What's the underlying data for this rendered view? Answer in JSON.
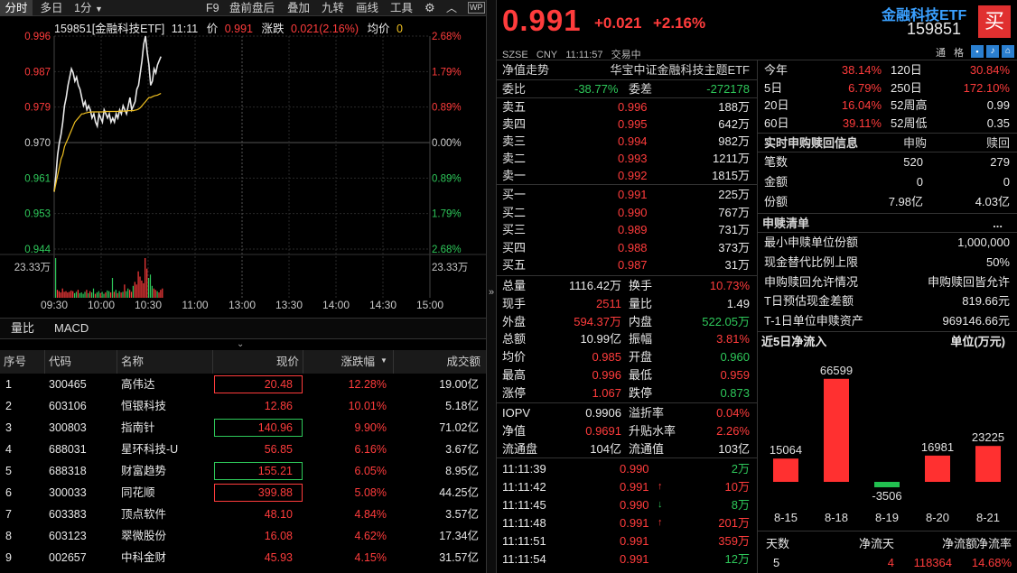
{
  "toolbar": {
    "left_items": [
      "分时",
      "多日",
      "1分"
    ],
    "right_items": [
      "F9",
      "盘前盘后",
      "叠加",
      "九转",
      "画线",
      "工具"
    ],
    "gear_icon": "gear-icon",
    "wechat_icon": "share-icon"
  },
  "chart_header": {
    "code_name": "159851[金融科技ETF]",
    "time": "11:11",
    "price_label": "价",
    "price": "0.991",
    "change_label": "涨跌",
    "change": "0.021(2.16%)",
    "avg_label": "均价",
    "avg": "0"
  },
  "chart_data": [
    {
      "type": "line",
      "x_ticks": [
        "09:30",
        "10:00",
        "10:30",
        "11:00",
        "13:00",
        "13:30",
        "14:00",
        "14:30",
        "15:00"
      ],
      "y_ticks_left": [
        "0.996",
        "0.987",
        "0.979",
        "0.970",
        "0.961",
        "0.953",
        "0.944"
      ],
      "y_ticks_right": [
        "2.68%",
        "1.79%",
        "0.89%",
        "0.00%",
        "0.89%",
        "1.79%",
        "2.68%"
      ],
      "ylim": [
        0.944,
        0.996
      ],
      "prev_close": 0.97,
      "series": [
        {
          "values": [
            0.958,
            0.962,
            0.967,
            0.97,
            0.972,
            0.975,
            0.979,
            0.981,
            0.984,
            0.986,
            0.988,
            0.987,
            0.985,
            0.986,
            0.984,
            0.983,
            0.981,
            0.979,
            0.98,
            0.978,
            0.979,
            0.978,
            0.976,
            0.977,
            0.975,
            0.974,
            0.977,
            0.976,
            0.975,
            0.978,
            0.977,
            0.976,
            0.977,
            0.975,
            0.976,
            0.975,
            0.977,
            0.976,
            0.978,
            0.977,
            0.979,
            0.978,
            0.977,
            0.979,
            0.981,
            0.978,
            0.979,
            0.98,
            0.983,
            0.984,
            0.987,
            0.99,
            0.994,
            0.996,
            0.992,
            0.989,
            0.984,
            0.985,
            0.988,
            0.987,
            0.989,
            0.99,
            0.991
          ]
        },
        {
          "values": [
            0.958,
            0.96,
            0.962,
            0.964,
            0.966,
            0.967,
            0.969,
            0.97,
            0.971,
            0.972,
            0.973,
            0.974,
            0.975,
            0.9755,
            0.976,
            0.9765,
            0.977,
            0.977,
            0.9772,
            0.9773,
            0.9774,
            0.9774,
            0.9775,
            0.9775,
            0.9775,
            0.9775,
            0.9775,
            0.9775,
            0.9775,
            0.9775,
            0.9776,
            0.9776,
            0.9776,
            0.9776,
            0.9776,
            0.9776,
            0.9776,
            0.9776,
            0.9777,
            0.9777,
            0.9777,
            0.9777,
            0.9777,
            0.9778,
            0.9778,
            0.9778,
            0.9778,
            0.9779,
            0.978,
            0.9782,
            0.9785,
            0.979,
            0.9795,
            0.98,
            0.9805,
            0.981,
            0.981,
            0.9812,
            0.9814,
            0.9815,
            0.9816,
            0.9818,
            0.982
          ]
        }
      ],
      "volume_label": "23.33万",
      "volume": [
        60,
        12,
        10,
        8,
        14,
        9,
        10,
        8,
        9,
        11,
        10,
        7,
        9,
        12,
        7,
        8,
        6,
        9,
        12,
        7,
        10,
        8,
        14,
        6,
        8,
        10,
        7,
        9,
        6,
        8,
        11,
        10,
        8,
        30,
        9,
        12,
        7,
        10,
        8,
        9,
        20,
        10,
        14,
        12,
        9,
        18,
        24,
        20,
        40,
        32,
        26,
        22,
        60,
        44,
        30,
        35,
        18,
        14,
        12,
        10,
        8,
        12,
        14
      ]
    },
    {
      "type": "bar",
      "title": "近5日净流入",
      "unit": "单位(万元)",
      "categories": [
        "8-15",
        "8-18",
        "8-19",
        "8-20",
        "8-21"
      ],
      "values": [
        15064,
        66599,
        -3506,
        16981,
        23225
      ]
    }
  ],
  "subtabs": [
    "量比",
    "MACD"
  ],
  "table": {
    "headers": [
      "序号",
      "代码",
      "名称",
      "现价",
      "涨跌幅",
      "成交额"
    ],
    "rows": [
      [
        "1",
        "300465",
        "高伟达",
        "20.48",
        "12.28%",
        "19.00亿"
      ],
      [
        "2",
        "603106",
        "恒银科技",
        "12.86",
        "10.01%",
        "5.18亿"
      ],
      [
        "3",
        "300803",
        "指南针",
        "140.96",
        "9.90%",
        "71.02亿"
      ],
      [
        "4",
        "688031",
        "星环科技-U",
        "56.85",
        "6.16%",
        "3.67亿"
      ],
      [
        "5",
        "688318",
        "财富趋势",
        "155.21",
        "6.05%",
        "8.95亿"
      ],
      [
        "6",
        "300033",
        "同花顺",
        "399.88",
        "5.08%",
        "44.25亿"
      ],
      [
        "7",
        "603383",
        "顶点软件",
        "48.10",
        "4.84%",
        "3.57亿"
      ],
      [
        "8",
        "603123",
        "翠微股份",
        "16.08",
        "4.62%",
        "17.34亿"
      ],
      [
        "9",
        "002657",
        "中科金财",
        "45.93",
        "4.15%",
        "31.57亿"
      ]
    ]
  },
  "quote": {
    "price": "0.991",
    "change": "+0.021",
    "change_pct": "+2.16%",
    "name": "金融科技ETF",
    "code": "159851",
    "buy_button": "买",
    "exchange": "SZSE",
    "currency": "CNY",
    "time": "11:11:57",
    "status": "交易中",
    "right_icons": [
      "通",
      "格",
      "bell-icon",
      "cart-icon"
    ],
    "nav_label": "净值走势",
    "index_name": "华宝中证金融科技主题ETF",
    "weibi_label": "委比",
    "weibi": "-38.77%",
    "weicha_label": "委差",
    "weicha": "-272178",
    "asks": [
      [
        "卖五",
        "0.996",
        "188万"
      ],
      [
        "卖四",
        "0.995",
        "642万"
      ],
      [
        "卖三",
        "0.994",
        "982万"
      ],
      [
        "卖二",
        "0.993",
        "1211万"
      ],
      [
        "卖一",
        "0.992",
        "1815万"
      ]
    ],
    "bids": [
      [
        "买一",
        "0.991",
        "225万"
      ],
      [
        "买二",
        "0.990",
        "767万"
      ],
      [
        "买三",
        "0.989",
        "731万"
      ],
      [
        "买四",
        "0.988",
        "373万"
      ],
      [
        "买五",
        "0.987",
        "31万"
      ]
    ],
    "stats": [
      [
        "总量",
        "1116.42万",
        "换手",
        "10.73%"
      ],
      [
        "现手",
        "2511",
        "量比",
        "1.49"
      ],
      [
        "外盘",
        "594.37万",
        "内盘",
        "522.05万"
      ],
      [
        "总额",
        "10.99亿",
        "振幅",
        "3.81%"
      ],
      [
        "均价",
        "0.985",
        "开盘",
        "0.960"
      ],
      [
        "最高",
        "0.996",
        "最低",
        "0.959"
      ],
      [
        "涨停",
        "1.067",
        "跌停",
        "0.873"
      ]
    ],
    "iopv": [
      [
        "IOPV",
        "0.9906",
        "溢折率",
        "0.04%"
      ],
      [
        "净值",
        "0.9691",
        "升贴水率",
        "2.26%"
      ],
      [
        "流通盘",
        "104亿",
        "流通值",
        "103亿"
      ]
    ],
    "ticks": [
      [
        "11:11:39",
        "0.990",
        "",
        "2万"
      ],
      [
        "11:11:42",
        "0.991",
        "↑",
        "10万"
      ],
      [
        "11:11:45",
        "0.990",
        "↓",
        "8万"
      ],
      [
        "11:11:48",
        "0.991",
        "↑",
        "201万"
      ],
      [
        "11:11:51",
        "0.991",
        "",
        "359万"
      ],
      [
        "11:11:54",
        "0.991",
        "",
        "12万"
      ]
    ]
  },
  "perf": [
    [
      "今年",
      "38.14%",
      "120日",
      "30.84%"
    ],
    [
      "5日",
      "6.79%",
      "250日",
      "172.10%"
    ],
    [
      "20日",
      "16.04%",
      "52周高",
      "0.99"
    ],
    [
      "60日",
      "39.11%",
      "52周低",
      "0.35"
    ]
  ],
  "sg": {
    "title": "实时申购赎回信息",
    "col1": "申购",
    "col2": "赎回",
    "rows": [
      [
        "笔数",
        "520",
        "279"
      ],
      [
        "金额",
        "0",
        "0"
      ],
      [
        "份额",
        "7.98亿",
        "4.03亿"
      ]
    ]
  },
  "list": {
    "title": "申赎清单",
    "more": "...",
    "rows": [
      [
        "最小申赎单位份额",
        "1,000,000"
      ],
      [
        "现金替代比例上限",
        "50%"
      ],
      [
        "申购赎回允许情况",
        "申购赎回皆允许"
      ],
      [
        "T日预估现金差额",
        "819.66元"
      ],
      [
        "T-1日单位申赎资产",
        "969146.66元"
      ]
    ]
  },
  "flow_summary": {
    "headers": [
      "天数",
      "净流天",
      "净流额",
      "净流率"
    ],
    "values": [
      "5",
      "4",
      "118364",
      "14.68%"
    ]
  }
}
